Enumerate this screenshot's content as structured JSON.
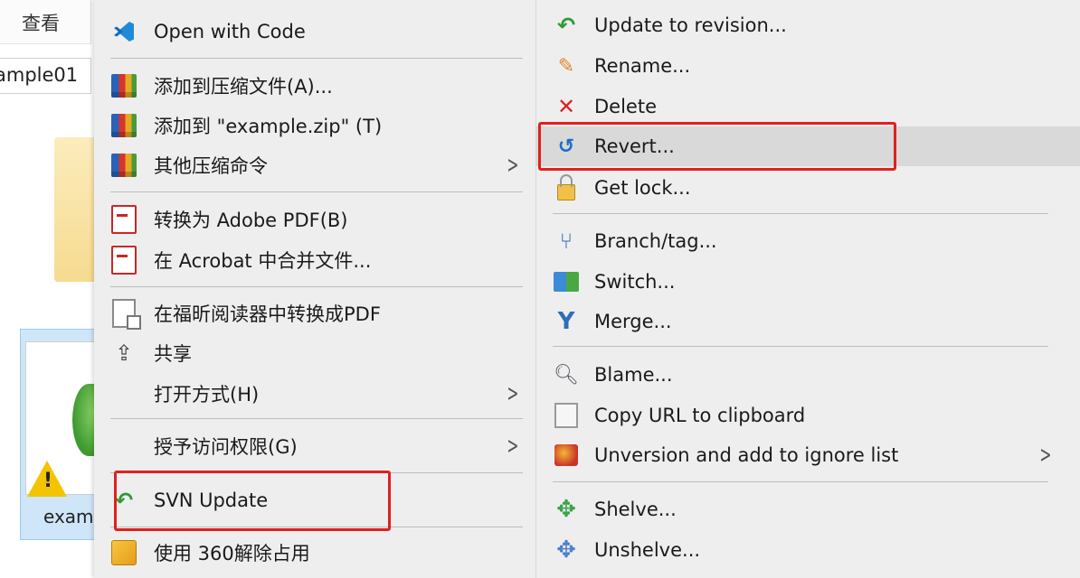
{
  "explorer": {
    "tab_label": "查看",
    "breadcrumb": "ample01",
    "file_label": "exam",
    "warning_mark": "!"
  },
  "main_menu": {
    "items": [
      {
        "label": "Open with Code",
        "icon": "vscode-icon"
      },
      {
        "label": "添加到压缩文件(A)...",
        "icon": "winrar-icon"
      },
      {
        "label": "添加到 \"example.zip\" (T)",
        "icon": "winrar-icon"
      },
      {
        "label": "其他压缩命令",
        "icon": "winrar-icon",
        "submenu": true
      },
      {
        "label": "转换为 Adobe PDF(B)",
        "icon": "pdf-icon"
      },
      {
        "label": "在 Acrobat 中合并文件...",
        "icon": "pdf-merge-icon"
      },
      {
        "label": "在福昕阅读器中转换成PDF",
        "icon": "foxit-icon"
      },
      {
        "label": "共享",
        "icon": "share-icon"
      },
      {
        "label": "打开方式(H)",
        "icon": "",
        "submenu": true
      },
      {
        "label": "授予访问权限(G)",
        "icon": "",
        "submenu": true
      },
      {
        "label": "SVN Update",
        "icon": "svn-update-icon"
      },
      {
        "label": "使用 360解除占用",
        "icon": "360-icon"
      }
    ]
  },
  "svn_submenu": {
    "items": [
      {
        "label": "Update to revision...",
        "icon": "svn-update-icon"
      },
      {
        "label": "Rename...",
        "icon": "pencil-icon"
      },
      {
        "label": "Delete",
        "icon": "delete-x-icon"
      },
      {
        "label": "Revert...",
        "icon": "revert-icon"
      },
      {
        "label": "Get lock...",
        "icon": "lock-icon"
      },
      {
        "label": "Branch/tag...",
        "icon": "branch-icon"
      },
      {
        "label": "Switch...",
        "icon": "switch-icon"
      },
      {
        "label": "Merge...",
        "icon": "merge-icon"
      },
      {
        "label": "Blame...",
        "icon": "blame-icon"
      },
      {
        "label": "Copy URL to clipboard",
        "icon": "copy-icon"
      },
      {
        "label": "Unversion and add to ignore list",
        "icon": "unversion-icon",
        "submenu": true
      },
      {
        "label": "Shelve...",
        "icon": "shelve-icon"
      },
      {
        "label": "Unshelve...",
        "icon": "unshelve-icon"
      }
    ]
  },
  "colors": {
    "menu_bg": "#eeeeee",
    "highlight": "#d9d9d9",
    "annotation_red": "#e02020",
    "selection_blue": "#cfe6f8"
  }
}
